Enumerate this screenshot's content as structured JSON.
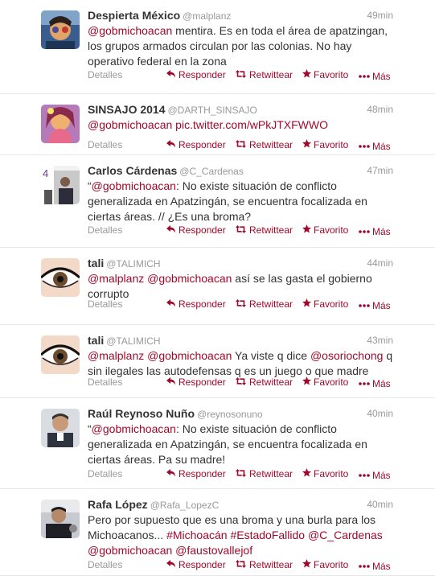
{
  "footer_labels": {
    "details": "Detalles",
    "reply": "Responder",
    "retweet": "Retwittear",
    "favorite": "Favorito",
    "more": "Más"
  },
  "tweets": [
    {
      "fullname": "Despierta México",
      "username": "@malplanz",
      "time": "49min",
      "segments": [
        {
          "t": "@gobmichoacan",
          "link": true
        },
        {
          "t": " mentira. Es en toda el área de apatzingan, los grupos armados circulan por las colonias. No hay operativo federal en la zona",
          "link": false
        }
      ]
    },
    {
      "fullname": "SINSAJO 2014",
      "username": "@DARTH_SINSAJO",
      "time": "48min",
      "segments": [
        {
          "t": "@gobmichoacan",
          "link": true
        },
        {
          "t": " ",
          "link": false
        },
        {
          "t": "pic.twitter.com/wPkJTXFWWO",
          "link": true
        }
      ]
    },
    {
      "fullname": "Carlos Cárdenas",
      "username": "@C_Cardenas",
      "time": "47min",
      "segments": [
        {
          "t": "“",
          "link": false
        },
        {
          "t": "@gobmichoacan",
          "link": true
        },
        {
          "t": ": No existe situación de conflicto generalizada en Apatzingán, se encuentra focalizada en ciertas áreas. // ¿Es una broma?",
          "link": false
        }
      ]
    },
    {
      "fullname": "tali",
      "username": "@TALIMICH",
      "time": "44min",
      "segments": [
        {
          "t": "@malplanz",
          "link": true
        },
        {
          "t": " ",
          "link": false
        },
        {
          "t": "@gobmichoacan",
          "link": true
        },
        {
          "t": " así se las gasta el gobierno corrupto",
          "link": false
        }
      ]
    },
    {
      "fullname": "tali",
      "username": "@TALIMICH",
      "time": "43min",
      "segments": [
        {
          "t": "@malplanz",
          "link": true
        },
        {
          "t": " ",
          "link": false
        },
        {
          "t": "@gobmichoacan",
          "link": true
        },
        {
          "t": " Ya viste q dice ",
          "link": false
        },
        {
          "t": "@osoriochong",
          "link": true
        },
        {
          "t": " q sin ilegales las autodefensas q es un juego o que madre",
          "link": false
        }
      ]
    },
    {
      "fullname": "Raúl Reynoso Nuño",
      "username": "@reynosonuno",
      "time": "40min",
      "segments": [
        {
          "t": "“",
          "link": false
        },
        {
          "t": "@gobmichoacan",
          "link": true
        },
        {
          "t": ": No existe situación de conflicto generalizada en Apatzingán, se encuentra focalizada en ciertas áreas. Pa su madre!",
          "link": false
        }
      ]
    },
    {
      "fullname": "Rafa López",
      "username": "@Rafa_LopezC",
      "time": "40min",
      "segments": [
        {
          "t": "Pero por supuesto que es una broma y una burla para los Michoacanos... ",
          "link": false
        },
        {
          "t": "#Michoacán",
          "link": true
        },
        {
          "t": " ",
          "link": false
        },
        {
          "t": "#EstadoFallido",
          "link": true
        },
        {
          "t": " ",
          "link": false
        },
        {
          "t": "@C_Cardenas",
          "link": true
        },
        {
          "t": " ",
          "link": false
        },
        {
          "t": "@gobmichoacan",
          "link": true
        },
        {
          "t": " ",
          "link": false
        },
        {
          "t": "@faustovallejof",
          "link": true
        }
      ]
    }
  ],
  "icons": {
    "reply": "reply-arrow-icon",
    "retweet": "retweet-icon",
    "favorite": "star-icon",
    "more": "ellipsis-icon"
  },
  "colors": {
    "link": "#a0092b",
    "meta": "#999999",
    "text": "#333333",
    "divider": "#e8e8e8"
  }
}
